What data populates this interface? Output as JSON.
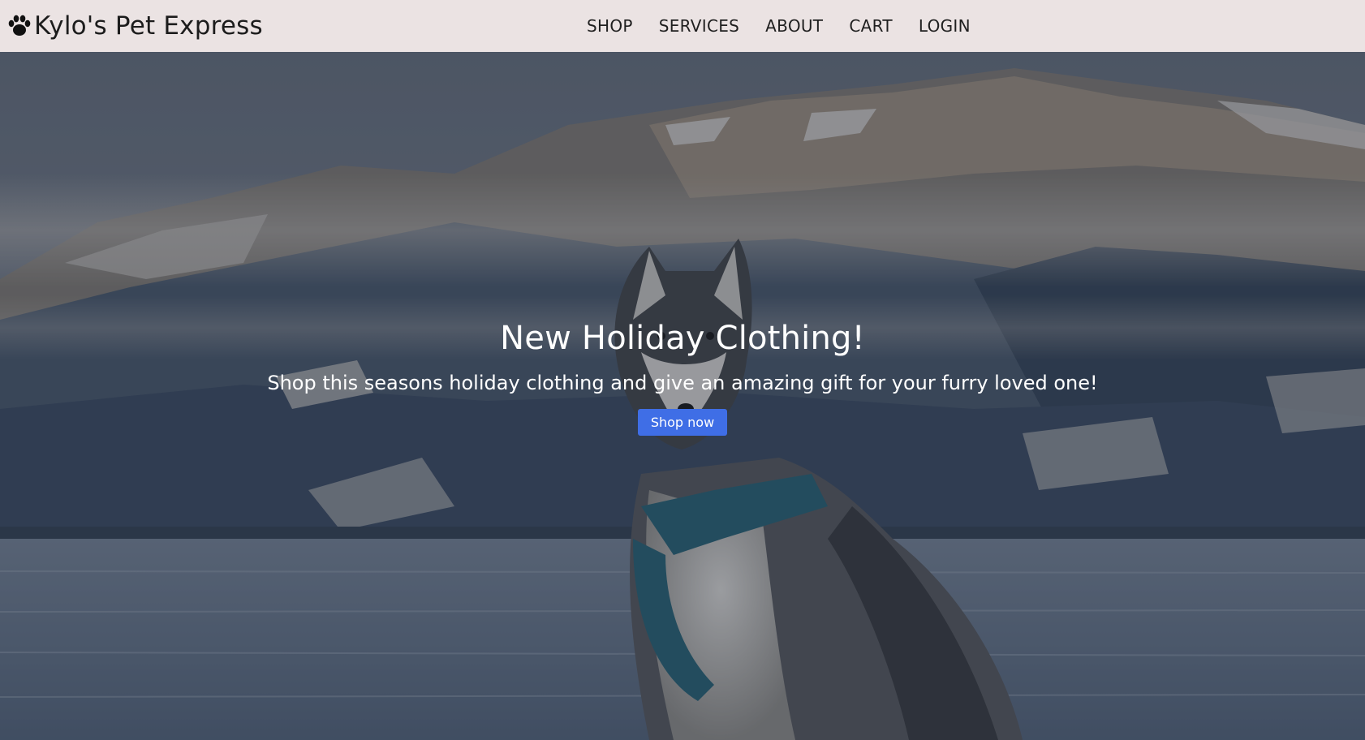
{
  "navbar": {
    "brand_icon": "paw-icon",
    "brand_name": "Kylo's Pet Express",
    "links": [
      {
        "label": "SHOP"
      },
      {
        "label": "SERVICES"
      },
      {
        "label": "ABOUT"
      },
      {
        "label": "CART"
      },
      {
        "label": "LOGIN"
      }
    ]
  },
  "hero": {
    "image": "husky-by-mountain-lake",
    "title": "New Holiday Clothing!",
    "subtitle": "Shop this seasons holiday clothing and give an amazing gift for your furry loved one!",
    "cta_label": "Shop now",
    "cta_color": "#3f6ee6"
  },
  "colors": {
    "navbar_bg": "#ebe3e3",
    "text_dark": "#1c1c1c",
    "hero_text": "#ffffff"
  }
}
